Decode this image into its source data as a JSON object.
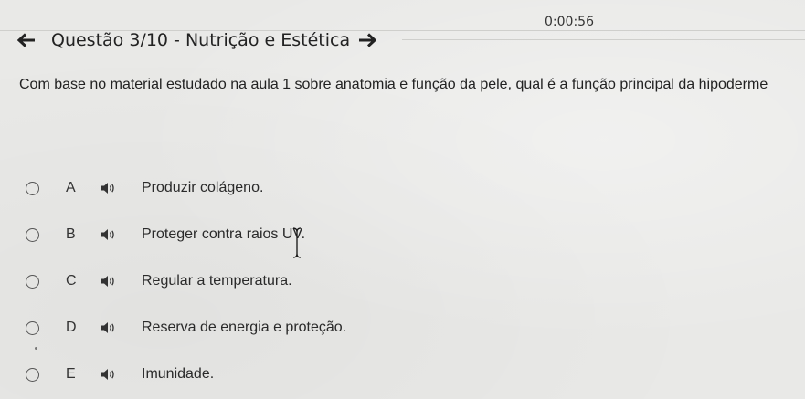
{
  "timer": {
    "value": "0:00:56"
  },
  "header": {
    "title": "Questão 3/10 - Nutrição e Estética",
    "prev_icon": "arrow-left-icon",
    "next_icon": "arrow-right-icon"
  },
  "question": {
    "text": "Com base no material estudado na aula 1 sobre anatomia e função da pele, qual é a função principal da hipoderme"
  },
  "options": [
    {
      "letter": "A",
      "text": "Produzir colágeno."
    },
    {
      "letter": "B",
      "text": "Proteger contra raios UV."
    },
    {
      "letter": "C",
      "text": "Regular a temperatura."
    },
    {
      "letter": "D",
      "text": "Reserva de energia e proteção."
    },
    {
      "letter": "E",
      "text": "Imunidade."
    }
  ],
  "icons": {
    "audio": "speaker-icon",
    "radio": "radio-icon"
  },
  "colors": {
    "background": "#e9e9e7",
    "text": "#2b2b2b"
  }
}
